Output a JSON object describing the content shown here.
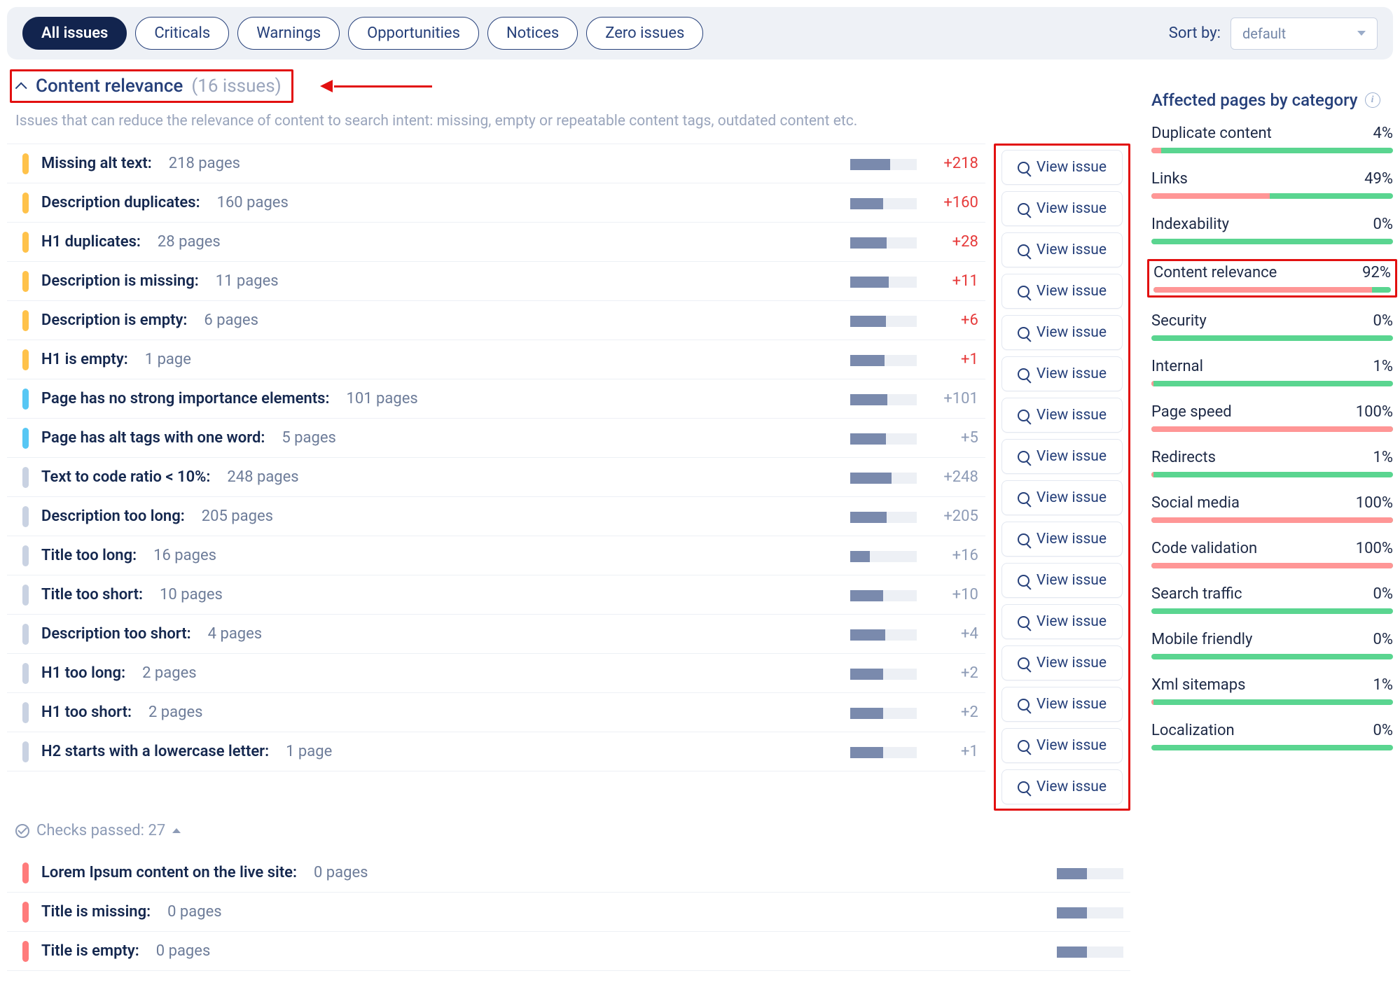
{
  "filters": {
    "pills": [
      {
        "id": "all",
        "label": "All issues",
        "active": true
      },
      {
        "id": "criticals",
        "label": "Criticals"
      },
      {
        "id": "warnings",
        "label": "Warnings"
      },
      {
        "id": "opportunities",
        "label": "Opportunities"
      },
      {
        "id": "notices",
        "label": "Notices"
      },
      {
        "id": "zero",
        "label": "Zero issues"
      }
    ],
    "sort_label": "Sort by:",
    "sort_value": "default"
  },
  "section": {
    "title": "Content relevance",
    "count_label": "(16 issues)",
    "description": "Issues that can reduce the relevance of content to search intent: missing, empty or repeatable content tags, outdated content etc."
  },
  "view_issue_label": "View issue",
  "issues": [
    {
      "sev": "warn",
      "name": "Missing alt text:",
      "count": "218 pages",
      "delta": "+218",
      "delta_cls": "red",
      "fill": 60
    },
    {
      "sev": "warn",
      "name": "Description duplicates:",
      "count": "160 pages",
      "delta": "+160",
      "delta_cls": "red",
      "fill": 50
    },
    {
      "sev": "warn",
      "name": "H1 duplicates:",
      "count": "28 pages",
      "delta": "+28",
      "delta_cls": "red",
      "fill": 55
    },
    {
      "sev": "warn",
      "name": "Description is missing:",
      "count": "11 pages",
      "delta": "+11",
      "delta_cls": "red",
      "fill": 58
    },
    {
      "sev": "warn",
      "name": "Description is empty:",
      "count": "6 pages",
      "delta": "+6",
      "delta_cls": "red",
      "fill": 54
    },
    {
      "sev": "warn",
      "name": "H1 is empty:",
      "count": "1 page",
      "delta": "+1",
      "delta_cls": "red",
      "fill": 52
    },
    {
      "sev": "opp",
      "name": "Page has no strong importance elements:",
      "count": "101 pages",
      "delta": "+101",
      "delta_cls": "gray",
      "fill": 56
    },
    {
      "sev": "opp",
      "name": "Page has alt tags with one word:",
      "count": "5 pages",
      "delta": "+5",
      "delta_cls": "gray",
      "fill": 54
    },
    {
      "sev": "notice",
      "name": "Text to code ratio < 10%:",
      "count": "248 pages",
      "delta": "+248",
      "delta_cls": "gray",
      "fill": 62
    },
    {
      "sev": "notice",
      "name": "Description too long:",
      "count": "205 pages",
      "delta": "+205",
      "delta_cls": "gray",
      "fill": 55
    },
    {
      "sev": "notice",
      "name": "Title too long:",
      "count": "16 pages",
      "delta": "+16",
      "delta_cls": "gray",
      "fill": 30
    },
    {
      "sev": "notice",
      "name": "Title too short:",
      "count": "10 pages",
      "delta": "+10",
      "delta_cls": "gray",
      "fill": 50
    },
    {
      "sev": "notice",
      "name": "Description too short:",
      "count": "4 pages",
      "delta": "+4",
      "delta_cls": "gray",
      "fill": 53
    },
    {
      "sev": "notice",
      "name": "H1 too long:",
      "count": "2 pages",
      "delta": "+2",
      "delta_cls": "gray",
      "fill": 50
    },
    {
      "sev": "notice",
      "name": "H1 too short:",
      "count": "2 pages",
      "delta": "+2",
      "delta_cls": "gray",
      "fill": 50
    },
    {
      "sev": "notice",
      "name": "H2 starts with a lowercase letter:",
      "count": "1 page",
      "delta": "+1",
      "delta_cls": "gray",
      "fill": 50
    }
  ],
  "checks_passed": {
    "label": "Checks passed: 27"
  },
  "passed_issues": [
    {
      "sev": "crit",
      "name": "Lorem Ipsum content on the live site:",
      "count": "0 pages"
    },
    {
      "sev": "crit",
      "name": "Title is missing:",
      "count": "0 pages"
    },
    {
      "sev": "crit",
      "name": "Title is empty:",
      "count": "0 pages"
    }
  ],
  "sidebar": {
    "title": "Affected pages by category",
    "categories": [
      {
        "name": "Duplicate content",
        "pct": "4%",
        "fill": 4
      },
      {
        "name": "Links",
        "pct": "49%",
        "fill": 49
      },
      {
        "name": "Indexability",
        "pct": "0%",
        "fill": 0
      },
      {
        "name": "Content relevance",
        "pct": "92%",
        "fill": 92,
        "highlight": true
      },
      {
        "name": "Security",
        "pct": "0%",
        "fill": 0
      },
      {
        "name": "Internal",
        "pct": "1%",
        "fill": 1
      },
      {
        "name": "Page speed",
        "pct": "100%",
        "fill": 100
      },
      {
        "name": "Redirects",
        "pct": "1%",
        "fill": 1
      },
      {
        "name": "Social media",
        "pct": "100%",
        "fill": 100
      },
      {
        "name": "Code validation",
        "pct": "100%",
        "fill": 100
      },
      {
        "name": "Search traffic",
        "pct": "0%",
        "fill": 0
      },
      {
        "name": "Mobile friendly",
        "pct": "0%",
        "fill": 0
      },
      {
        "name": "Xml sitemaps",
        "pct": "1%",
        "fill": 1
      },
      {
        "name": "Localization",
        "pct": "0%",
        "fill": 0
      }
    ]
  }
}
